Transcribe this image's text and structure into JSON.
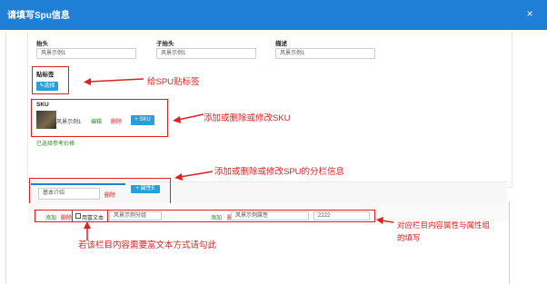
{
  "window": {
    "title": "请填写Spu信息",
    "close": "×"
  },
  "fields": {
    "header_label": "抬头",
    "sub_header_label": "子抬头",
    "desc_label": "描述",
    "header_value": "风景示例1",
    "sub_header_value": "风景示例1",
    "desc_value": "风景示例1"
  },
  "tags": {
    "label": "贴标签",
    "button": "✎选择"
  },
  "sku": {
    "label": "SKU",
    "item_name": "风景示例1",
    "edit": "编辑",
    "delete": "删除",
    "add_button": "+ SKU",
    "ref_price_link": "已选择参考价格"
  },
  "tabs": {
    "input_value": "基本介绍",
    "delete": "删除",
    "add_button": "+ 属性E"
  },
  "attributes": {
    "add1": "添加",
    "del1": "删除",
    "richtext_label": "用富文本",
    "group_value": "风景示例分组",
    "add2": "添加",
    "del2": "删除",
    "attr_name": "风景示例属性",
    "attr_value": "2222"
  },
  "annotations": {
    "tag": "给SPU贴标签",
    "sku": "添加或删除或修改SKU",
    "tabs": "添加或删除或修改SPU的分栏信息",
    "attrs_line1": "对应栏目内容属性与属性组",
    "attrs_line2": "的填写",
    "richtext": "若该栏目内容需要富文本方式请勾此"
  },
  "colors": {
    "header": "#1f7fd6",
    "annotation": "#e02020",
    "button": "#2a9fd6"
  }
}
